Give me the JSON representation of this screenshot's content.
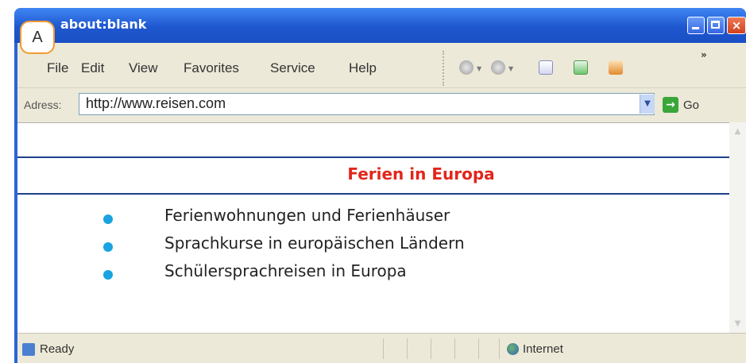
{
  "badge": "A",
  "window": {
    "title": "about:blank",
    "close_glyph": "×"
  },
  "menu": {
    "items": [
      "File",
      "Edit",
      "View",
      "Favorites",
      "Service",
      "Help"
    ],
    "overflow": "»"
  },
  "toolbar_icons": [
    "back-icon",
    "forward-icon",
    "stop-icon",
    "refresh-icon",
    "home-icon"
  ],
  "address": {
    "label": "Adress:",
    "url": "http://www.reisen.com",
    "go_label": "Go"
  },
  "page": {
    "heading": "Ferien in Europa",
    "items": [
      "Ferienwohnungen und Ferienhäuser",
      "Sprachkurse in europäischen Ländern",
      "Schülersprachreisen in Europa"
    ]
  },
  "status": {
    "text": "Ready",
    "zone": "Internet"
  },
  "colors": {
    "heading": "#e2261c",
    "bullet": "#1aa3e0",
    "titlebar": "#2a64d6",
    "badge_border": "#f29a2e"
  }
}
